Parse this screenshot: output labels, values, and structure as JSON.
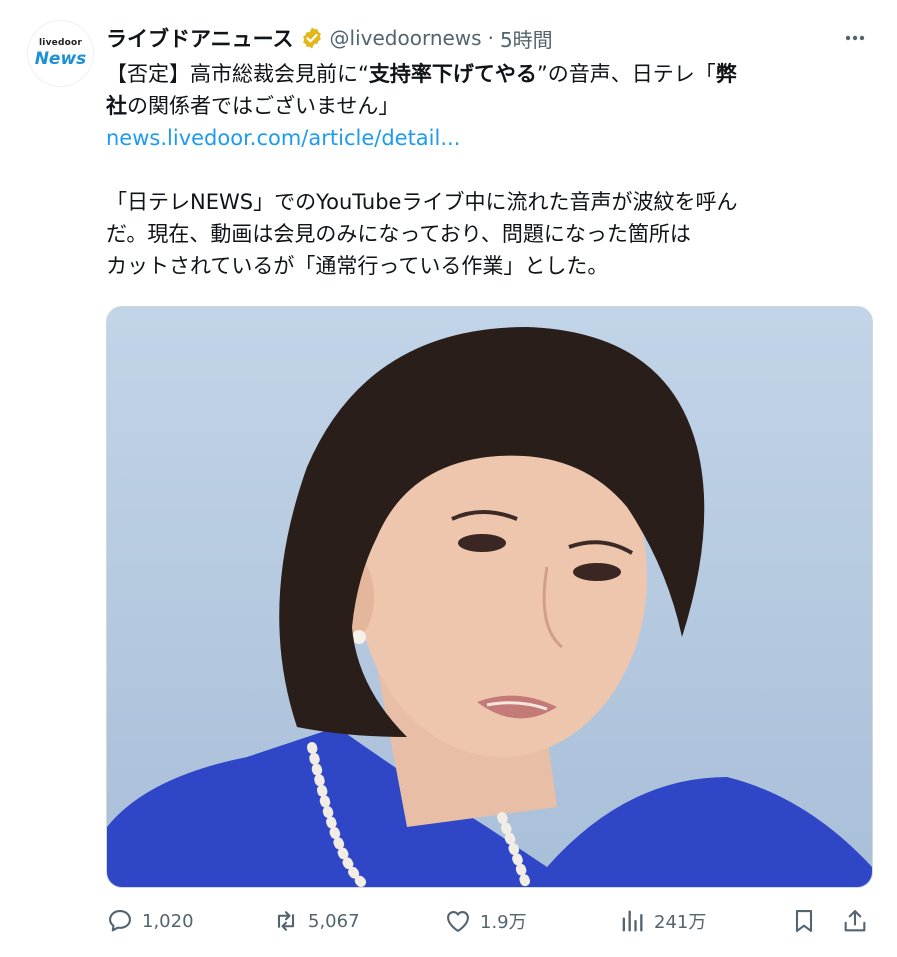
{
  "account": {
    "avatar_small": "livedoor",
    "avatar_big": "News",
    "display_name": "ライブドアニュース",
    "handle": "@livedoornews",
    "time_sep": "·",
    "time": "5時間"
  },
  "tweet": {
    "line1_a": "【否定】高市総裁会見前に“",
    "line1_b": "支持率下げてやる",
    "line1_c": "”の音声、日テレ「",
    "line1_d": "弊",
    "line2_a": "社",
    "line2_b": "の関係者ではございません」",
    "link": "news.livedoor.com/article/detail...",
    "body1": "「日テレNEWS」でのYouTubeライブ中に流れた音声が波紋を呼ん",
    "body2": "だ。現在、動画は会見のみになっており、問題になった箇所は",
    "body3": "カットされているが「通常行っている作業」とした。"
  },
  "actions": {
    "replies": "1,020",
    "reposts": "5,067",
    "likes": "1.9万",
    "views": "241万"
  },
  "colors": {
    "text": "#0f1419",
    "secondary": "#536471",
    "link": "#1d9bf0",
    "verified_gold": "#e2b719",
    "jacket_blue": "#2f47c6"
  },
  "icons": [
    "verified-badge-icon",
    "more-icon",
    "reply-icon",
    "repost-icon",
    "like-icon",
    "views-icon",
    "bookmark-icon",
    "share-icon"
  ]
}
